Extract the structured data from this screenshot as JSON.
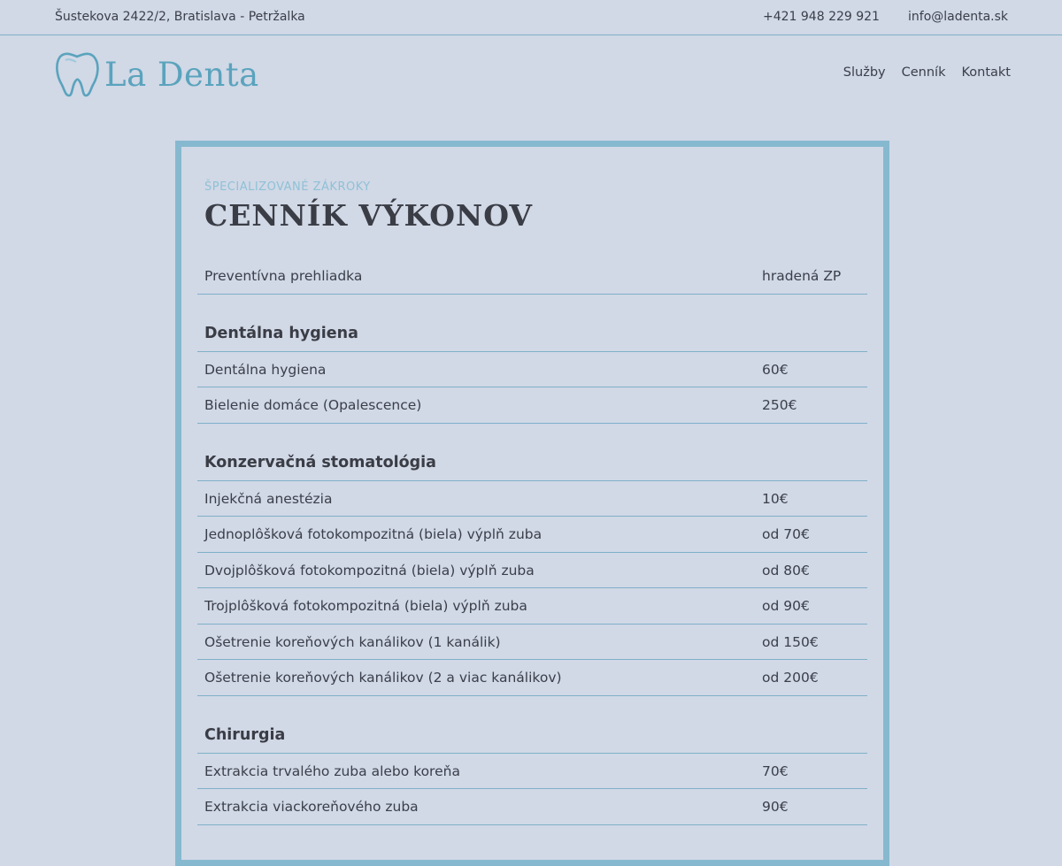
{
  "topbar": {
    "address": "Šustekova 2422/2, Bratislava - Petržalka",
    "phone": "+421 948 229 921",
    "email": "info@ladenta.sk"
  },
  "logo": {
    "text": "La Denta",
    "icon": "tooth-icon"
  },
  "nav": {
    "services": "Služby",
    "pricing": "Cenník",
    "contact": "Kontakt"
  },
  "pricelist": {
    "eyebrow": "ŠPECIALIZOVANÉ ZÁKROKY",
    "title": "CENNÍK VÝKONOV",
    "preventive": {
      "name": "Preventívna prehliadka",
      "price": "hradená ZP"
    },
    "sections": [
      {
        "title": "Dentálna hygiena",
        "items": [
          {
            "name": "Dentálna hygiena",
            "price": "60€"
          },
          {
            "name": "Bielenie domáce (Opalescence)",
            "price": "250€"
          }
        ]
      },
      {
        "title": "Konzervačná stomatológia",
        "items": [
          {
            "name": "Injekčná anestézia",
            "price": "10€"
          },
          {
            "name": "Jednoplôšková fotokompozitná (biela) výplň zuba",
            "price": "od 70€"
          },
          {
            "name": "Dvojplôšková fotokompozitná (biela) výplň zuba",
            "price": "od 80€"
          },
          {
            "name": "Trojplôšková fotokompozitná (biela) výplň zuba",
            "price": "od 90€"
          },
          {
            "name": "Ošetrenie koreňových kanálikov (1 kanálik)",
            "price": "od 150€"
          },
          {
            "name": "Ošetrenie koreňových kanálikov (2 a viac kanálikov)",
            "price": "od 200€"
          }
        ]
      },
      {
        "title": "Chirurgia",
        "items": [
          {
            "name": "Extrakcia trvalého zuba alebo koreňa",
            "price": "70€"
          },
          {
            "name": "Extrakcia viackoreňového zuba",
            "price": "90€"
          }
        ]
      }
    ]
  },
  "colors": {
    "background": "#d1d8e6",
    "accent": "#86b9cf",
    "text": "#3a3d45"
  }
}
